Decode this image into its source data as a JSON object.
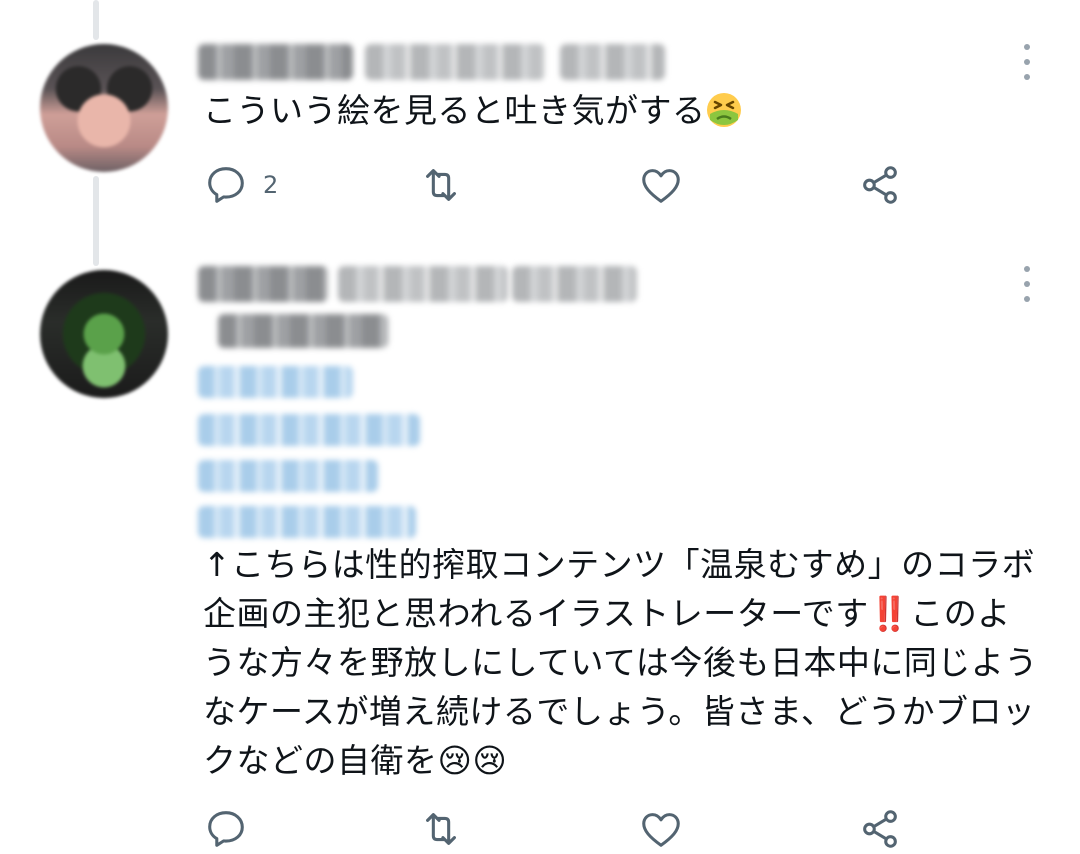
{
  "tweets": [
    {
      "text": "こういう絵を見ると吐き気がする",
      "emoji": [
        "nauseated-face"
      ],
      "actions": {
        "reply_count": "2",
        "retweet_count": "",
        "like_count": ""
      }
    },
    {
      "text": "↑こちらは性的搾取コンテンツ「温泉むすめ」のコラボ企画の主犯と思われるイラストレーターです‼️このような方々を野放しにしていては今後も日本中に同じようなケースが増え続けるでしょう。皆さま、どうかブロックなどの自衛を😢😢",
      "actions": {
        "reply_count": "",
        "retweet_count": "",
        "like_count": ""
      }
    }
  ],
  "icons": {
    "reply": "reply-icon",
    "retweet": "retweet-icon",
    "like": "heart-icon",
    "share": "share-icon",
    "more": "more-vertical-icon"
  },
  "colors": {
    "text": "#0f1419",
    "icon": "#536471",
    "thread_line": "#e3e6e9",
    "emoji_green": "#8cc63f",
    "emoji_red": "#e0245e",
    "emoji_yellow": "#ffcc4d"
  }
}
